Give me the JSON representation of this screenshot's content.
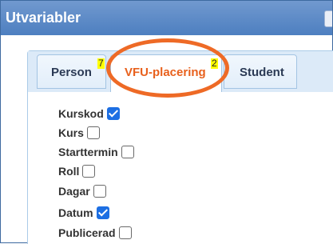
{
  "window": {
    "title": "Utvariabler"
  },
  "tabs": [
    {
      "label": "Person",
      "count": "7",
      "active": false
    },
    {
      "label": "VFU-placering",
      "count": "2",
      "active": true
    },
    {
      "label": "Student",
      "count": "",
      "active": false
    }
  ],
  "fields": [
    {
      "label": "Kurskod",
      "checked": true
    },
    {
      "label": "Kurs",
      "checked": false
    },
    {
      "label": "Starttermin",
      "checked": false
    },
    {
      "label": "Roll",
      "checked": false
    },
    {
      "label": "Dagar",
      "checked": false
    },
    {
      "label": "Datum",
      "checked": true
    },
    {
      "label": "Publicerad",
      "checked": false
    }
  ],
  "colors": {
    "titlebar": "#4d7fc0",
    "active_tab_text": "#e8601c",
    "highlight_ellipse": "#ee6a26",
    "count_badge": "#ffff00",
    "checkbox_checked": "#1d6fe3"
  }
}
